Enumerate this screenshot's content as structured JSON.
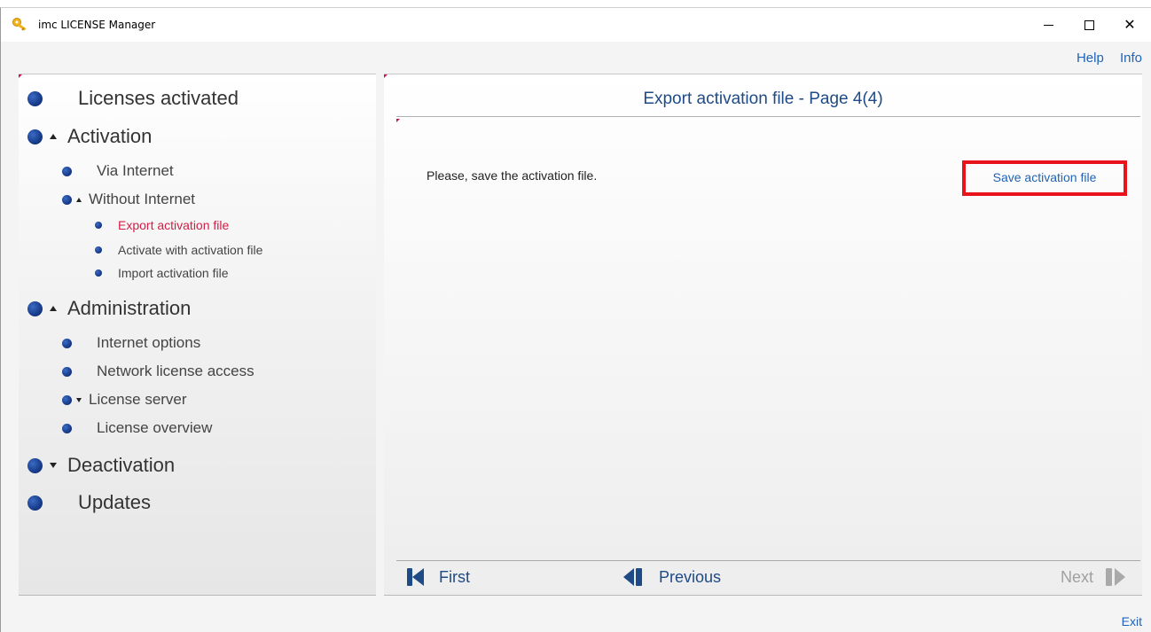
{
  "window": {
    "title": "imc LICENSE Manager",
    "minimize_glyph": "—",
    "maximize_glyph": "☐",
    "close_glyph": "✕"
  },
  "top_links": {
    "help": "Help",
    "info": "Info"
  },
  "nav": {
    "licenses_activated": "Licenses activated",
    "activation": "Activation",
    "via_internet": "Via Internet",
    "without_internet": "Without Internet",
    "export_activation_file": "Export activation file",
    "activate_with_activation_file": "Activate with activation file",
    "import_activation_file": "Import activation file",
    "administration": "Administration",
    "internet_options": "Internet options",
    "network_license_access": "Network license access",
    "license_server": "License server",
    "license_overview": "License overview",
    "deactivation": "Deactivation",
    "updates": "Updates"
  },
  "content": {
    "page_title": "Export activation file - Page 4(4)",
    "instruction": "Please, save the activation file.",
    "save_link": "Save activation file"
  },
  "footer_nav": {
    "first": "First",
    "previous": "Previous",
    "next": "Next"
  },
  "exit": "Exit",
  "colors": {
    "link_blue": "#1f63b8",
    "title_blue": "#1e4a86",
    "active_red": "#d21d45",
    "highlight_red": "#e8131b",
    "bullet_blue": "#1a3f8f"
  }
}
